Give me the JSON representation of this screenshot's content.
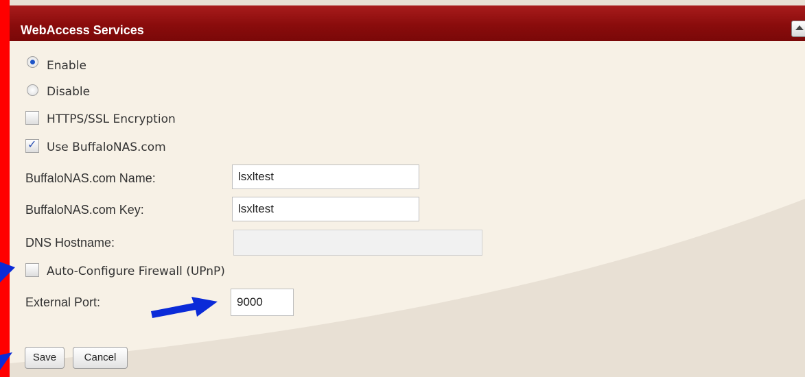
{
  "panel": {
    "title": "WebAccess Services"
  },
  "colors": {
    "frame_red": "#ff0000",
    "title_bar": "#8a0c0c",
    "arrow_blue": "#0b2bd8",
    "radio_selected": "#1d54c7"
  },
  "service_state": {
    "options": [
      {
        "label": "Enable",
        "selected": true
      },
      {
        "label": "Disable",
        "selected": false
      }
    ]
  },
  "https": {
    "label": "HTTPS/SSL Encryption",
    "checked": false
  },
  "buffalonas": {
    "label": "Use BuffaloNAS.com",
    "checked": true
  },
  "fields": {
    "name": {
      "label": "BuffaloNAS.com Name:",
      "value": "lsxltest"
    },
    "key": {
      "label": "BuffaloNAS.com Key:",
      "value": "lsxltest"
    },
    "dns": {
      "label": "DNS Hostname:",
      "value": ""
    },
    "port": {
      "label": "External Port:",
      "value": "9000"
    }
  },
  "upnp": {
    "label": "Auto-Configure Firewall (UPnP)",
    "checked": false
  },
  "buttons": {
    "save": "Save",
    "cancel": "Cancel"
  },
  "icons": {
    "collapse": "chevron-up-icon",
    "annotation": "arrow-icon"
  }
}
